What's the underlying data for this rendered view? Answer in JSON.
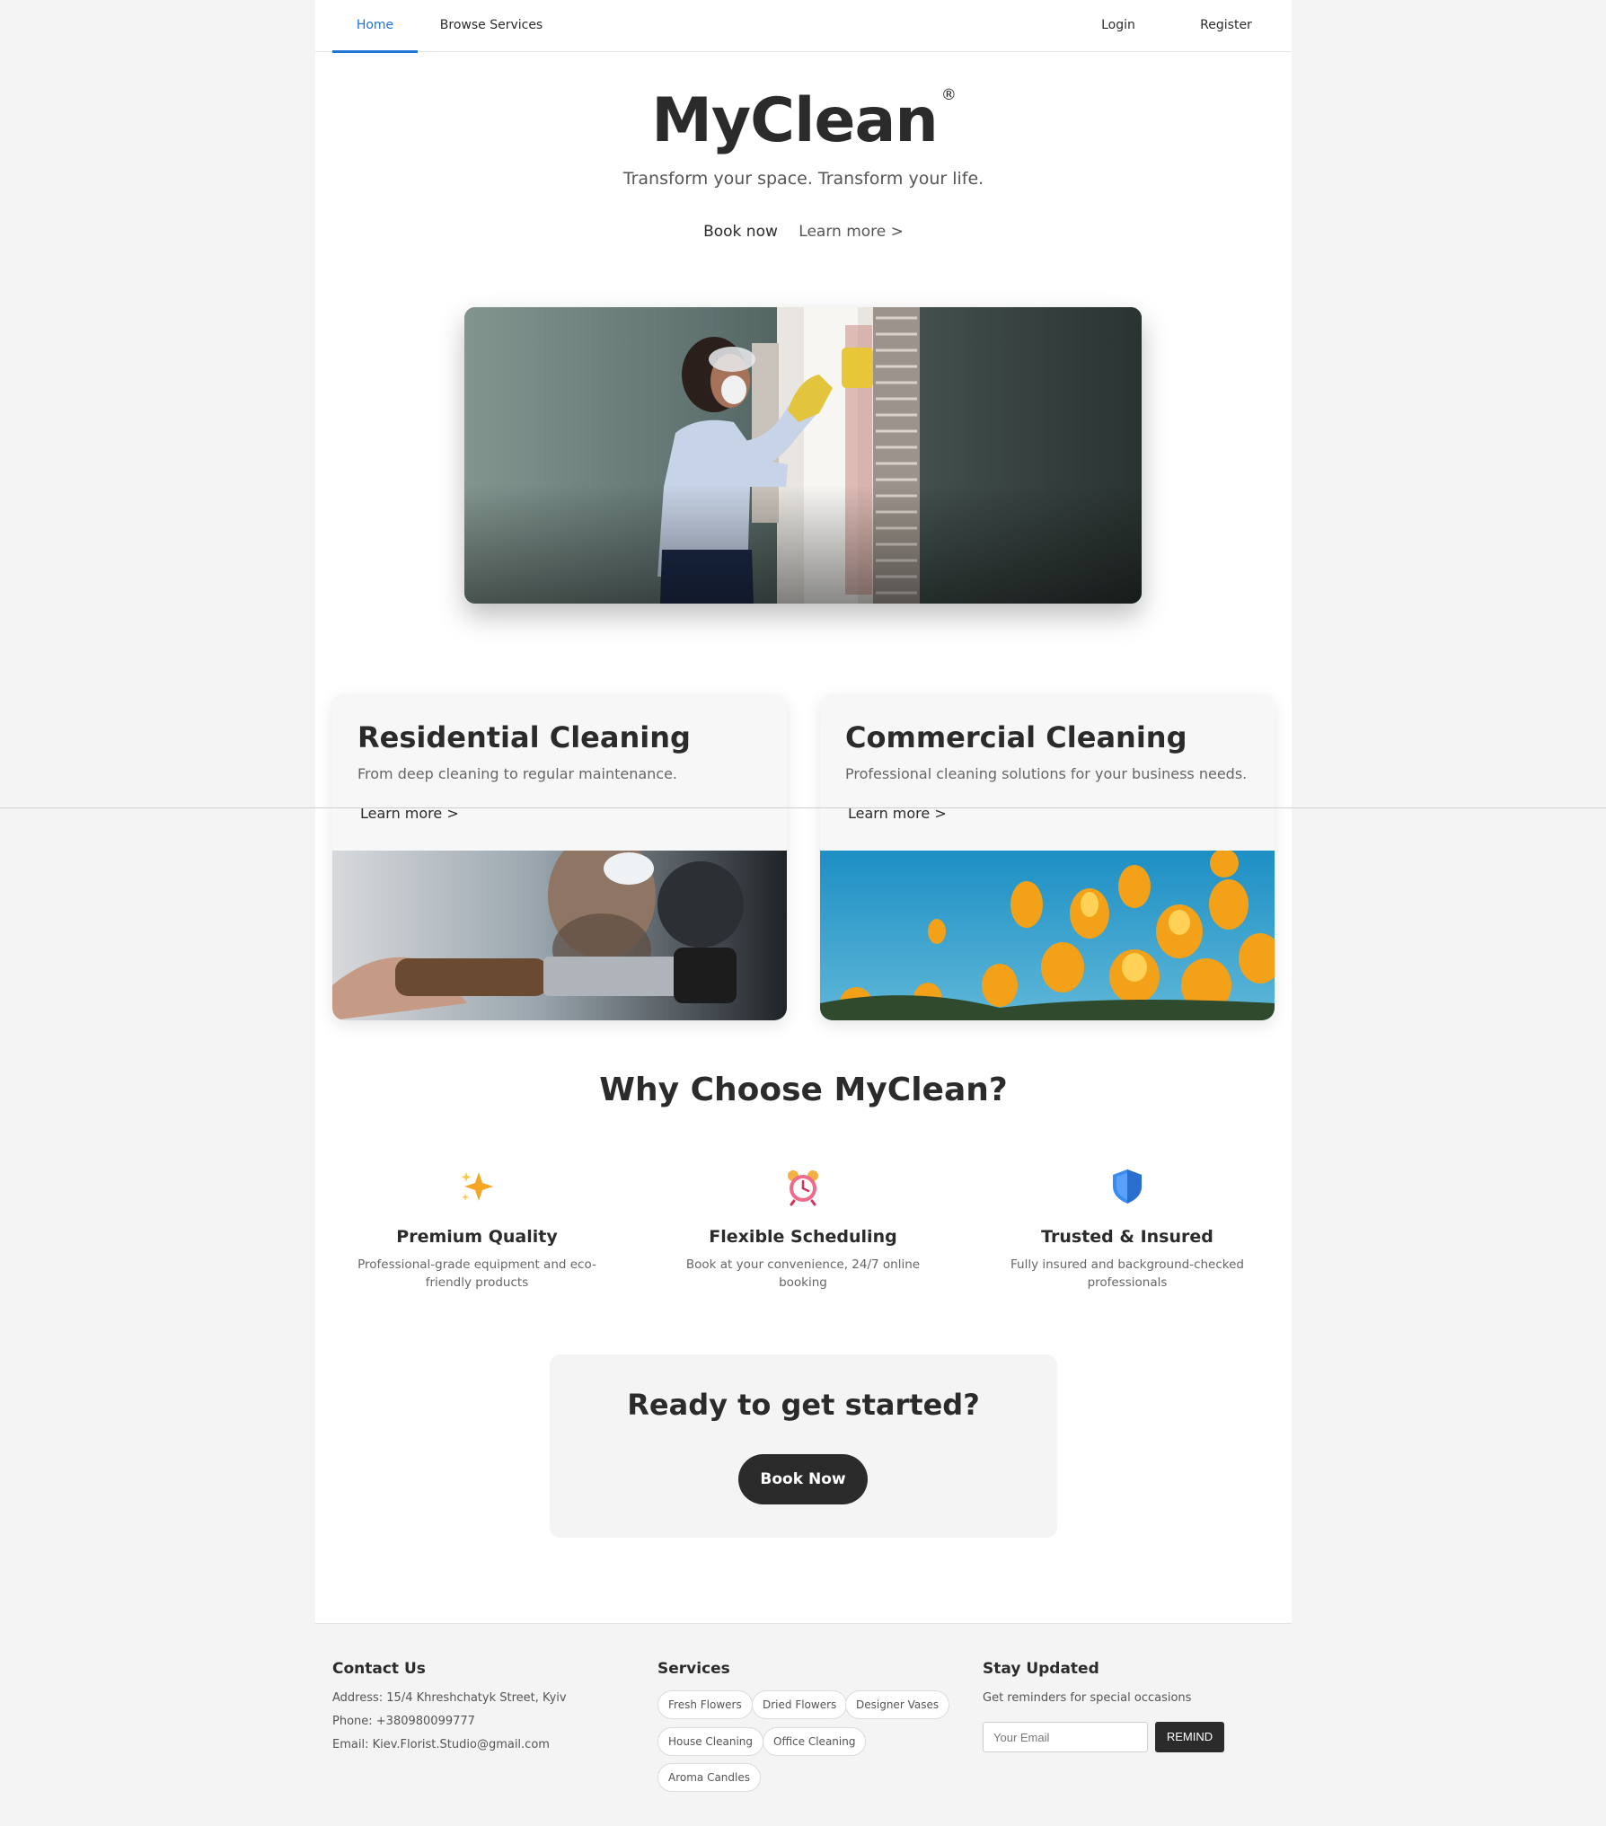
{
  "nav": {
    "home": "Home",
    "browse": "Browse Services",
    "login": "Login",
    "register": "Register"
  },
  "hero": {
    "brand": "MyClean",
    "registered": "®",
    "tagline": "Transform your space. Transform your life.",
    "book_now": "Book now",
    "learn_more": "Learn more >"
  },
  "cards": [
    {
      "title": "Residential Cleaning",
      "description": "From deep cleaning to regular maintenance.",
      "link": "Learn more >"
    },
    {
      "title": "Commercial Cleaning",
      "description": "Professional cleaning solutions for your business needs.",
      "link": "Learn more >"
    }
  ],
  "why": {
    "title": "Why Choose MyClean?",
    "features": [
      {
        "icon": "sparkles-icon",
        "title": "Premium Quality",
        "line1": "Professional-grade equipment and eco-",
        "line2": "friendly products"
      },
      {
        "icon": "alarm-clock-icon",
        "title": "Flexible Scheduling",
        "line1": "Book at your convenience, 24/7 online",
        "line2": "booking"
      },
      {
        "icon": "shield-icon",
        "title": "Trusted & Insured",
        "line1": "Fully insured and background-checked",
        "line2": "professionals"
      }
    ]
  },
  "cta": {
    "title": "Ready to get started?",
    "button": "Book Now"
  },
  "footer": {
    "contact": {
      "heading": "Contact Us",
      "address": "Address: 15/4 Khreshchatyk Street, Kyiv",
      "phone": "Phone: +380980099777",
      "email": "Email: Kiev.Florist.Studio@gmail.com"
    },
    "services": {
      "heading": "Services",
      "tags": [
        "Fresh Flowers",
        "Dried Flowers",
        "Designer Vases",
        "House Cleaning",
        "Office Cleaning",
        "Aroma Candles"
      ]
    },
    "updates": {
      "heading": "Stay Updated",
      "text": "Get reminders for special occasions",
      "placeholder": "Your Email",
      "button": "REMIND"
    }
  },
  "colors": {
    "accent": "#1f74d4",
    "dark": "#2b2b2b",
    "background": "#f4f4f5"
  }
}
